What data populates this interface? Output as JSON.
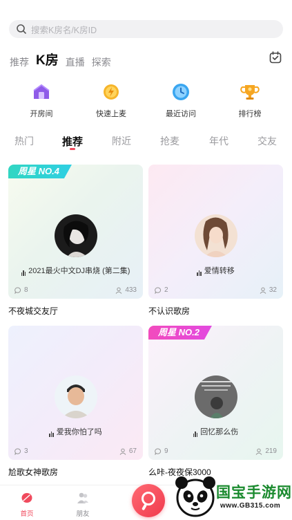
{
  "search": {
    "placeholder": "搜索K房名/K房ID"
  },
  "top_tabs": [
    "推荐",
    "K房",
    "直播",
    "探索"
  ],
  "quick_actions": [
    {
      "label": "开房间",
      "icon": "house-icon"
    },
    {
      "label": "快速上麦",
      "icon": "bolt-coin-icon"
    },
    {
      "label": "最近访问",
      "icon": "clock-icon"
    },
    {
      "label": "排行榜",
      "icon": "trophy-icon"
    }
  ],
  "categories": [
    "热门",
    "推荐",
    "附近",
    "抢麦",
    "年代",
    "交友"
  ],
  "rooms": [
    {
      "badge": "周星 NO.4",
      "song": "2021最火中文DJ串烧 (第二集)",
      "comments": "8",
      "listeners": "433",
      "name": "不夜城交友厅"
    },
    {
      "badge": "",
      "song": "爱情转移",
      "comments": "2",
      "listeners": "32",
      "name": "不认识歌房"
    },
    {
      "badge": "",
      "song": "爱我你怕了吗",
      "comments": "3",
      "listeners": "67",
      "name": "尬歌女神歌房"
    },
    {
      "badge": "周星 NO.2",
      "song": "回忆那么伤",
      "comments": "9",
      "listeners": "219",
      "name": "么咔-夜夜保3000"
    }
  ],
  "bottom_nav": {
    "home": "首页",
    "friends": "朋友"
  },
  "watermark": {
    "text": "国宝手游网",
    "url": "www.GB315.com"
  },
  "colors": {
    "accent": "#f04a5d",
    "badge_teal": "#31d6c2",
    "badge_pink": "#f24bbd"
  }
}
